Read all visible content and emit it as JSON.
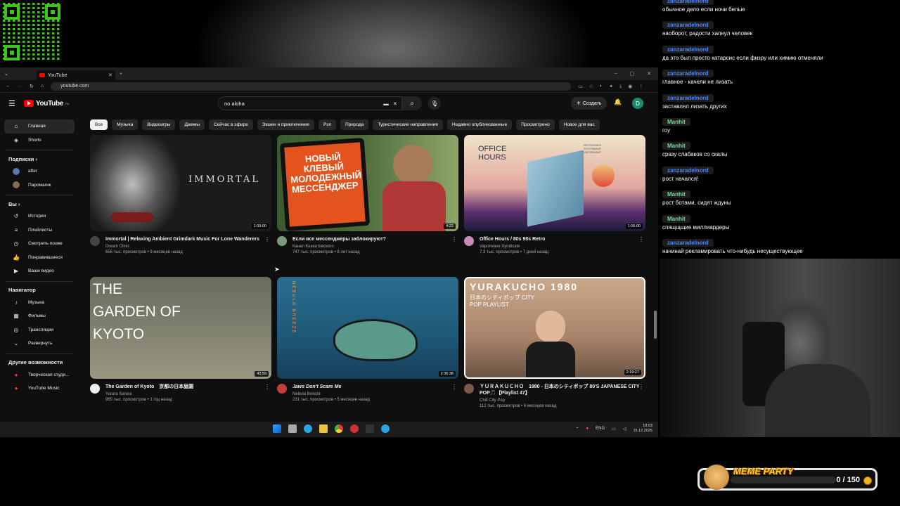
{
  "browser": {
    "tab_title": "YouTube",
    "url": "youtube.com"
  },
  "youtube": {
    "logo_text": "YouTube",
    "logo_region": "RU",
    "search_value": "no aloha",
    "create_label": "Создать",
    "avatar_letter": "D",
    "chips": [
      "Все",
      "Музыка",
      "Видеоигры",
      "Джемы",
      "Сейчас в эфире",
      "Экшен и приключения",
      "Рэп",
      "Природа",
      "Туристические направления",
      "Недавно опубликованные",
      "Просмотрено",
      "Новое для вас"
    ],
    "sidebar": {
      "main": [
        "Главная",
        "Shorts"
      ],
      "subs_header": "Подписки",
      "subs": [
        "after",
        "Паромагик"
      ],
      "you_header": "Вы",
      "you": [
        "История",
        "Плейлисты",
        "Смотреть позже",
        "Понравившиеся",
        "Ваши видео"
      ],
      "nav_header": "Навигатор",
      "nav": [
        "Музыка",
        "Фильмы",
        "Трансляции",
        "Развернуть"
      ],
      "more_header": "Другие возможности",
      "more": [
        "Творческая студи...",
        "YouTube Music"
      ]
    },
    "videos": [
      {
        "title": "Immortal | Relaxing Ambient Grimdark Music For Lone Wanderers",
        "channel": "Dream Clinic",
        "stats": "656 тыс. просмотров • 9 месяцев назад",
        "duration": "1:00:00",
        "thumb_text": "IMMORTAL",
        "thumb_sub": ""
      },
      {
        "title": "Если все мессенджеры заблокируют?",
        "channel": "Канал Кшиштовского",
        "stats": "747 тыс. просмотров • 8 лет назад",
        "duration": "4:22",
        "thumb_text": "НОВЫЙ КЛЕВЫЙ МОЛОДЕЖНЫЙ МЕССЕНДЖЕР",
        "thumb_sub": ""
      },
      {
        "title": "Office Hours / 80s 90s Retro",
        "channel": "Vaporwave Syndicate",
        "stats": "7,3 тыс. просмотров • 7 дней назад",
        "duration": "1:06:00",
        "thumb_text": "OFFICE HOURS",
        "thumb_sub": "RETROWAVE SYNTHWAVE VAPORWAVE"
      },
      {
        "title": "The Garden of Kyoto　京都の日本庭園",
        "channel": "Yurara Sarara",
        "stats": "965 тыс. просмотров • 1 год назад",
        "duration": "43:59",
        "thumb_text": "THE GARDEN OF KYOTO",
        "thumb_sub": ""
      },
      {
        "title": "Jaws Don't Scare Me",
        "channel": "Nebula Breeze",
        "stats": "231 тыс. просмотров • 5 месяцев назад",
        "duration": "2:36:38",
        "thumb_text": "NEBULA BREEZE",
        "thumb_sub": ""
      },
      {
        "title": "ＹＵＲＡＫＵＣＨＯ　1980 - 日本のシティポップ 80'S JAPANESE CITY POP🎵【Playlist 47】",
        "channel": "Chill City Pop",
        "stats": "112 тыс. просмотров • 6 месяцев назад",
        "duration": "2:19:27",
        "thumb_text": "YURAKUCHO 1980",
        "thumb_sub": "日本のシティポップ CITY POP PLAYLIST"
      }
    ]
  },
  "taskbar": {
    "lang": "ENG",
    "time": "19:03",
    "date": "15.12.2025"
  },
  "chat": [
    {
      "user": "zanzaradelnord",
      "color": "#4f86ff",
      "msg": "обычное дело если ночи белые"
    },
    {
      "user": "zanzaradelnord",
      "color": "#4f86ff",
      "msg": "наоборот, радости хапнул человек"
    },
    {
      "user": "zanzaradelnord",
      "color": "#4f86ff",
      "msg": "да это был просто катарсис если физру или химию отменяли"
    },
    {
      "user": "zanzaradelnord",
      "color": "#4f86ff",
      "msg": "главное - качели не лизать"
    },
    {
      "user": "zanzaradelnord",
      "color": "#4f86ff",
      "msg": "заставлял лизать других"
    },
    {
      "user": "Manhit",
      "color": "#7fd6a4",
      "msg": "гоу"
    },
    {
      "user": "Manhit",
      "color": "#7fd6a4",
      "msg": "сразу слабаков со скалы"
    },
    {
      "user": "zanzaradelnord",
      "color": "#4f86ff",
      "msg": "рост начался!"
    },
    {
      "user": "Manhit",
      "color": "#7fd6a4",
      "msg": "рост ботами, сидят ждуны"
    },
    {
      "user": "Manhit",
      "color": "#7fd6a4",
      "msg": "спящщщие миллиардеры"
    },
    {
      "user": "zanzaradelnord",
      "color": "#4f86ff",
      "msg": "начинай рекламировать что-нибудь несуществующее"
    }
  ],
  "meme_party": {
    "title": "MEME PARTY",
    "progress_text": "0 / 150",
    "progress_fraction": 0
  }
}
